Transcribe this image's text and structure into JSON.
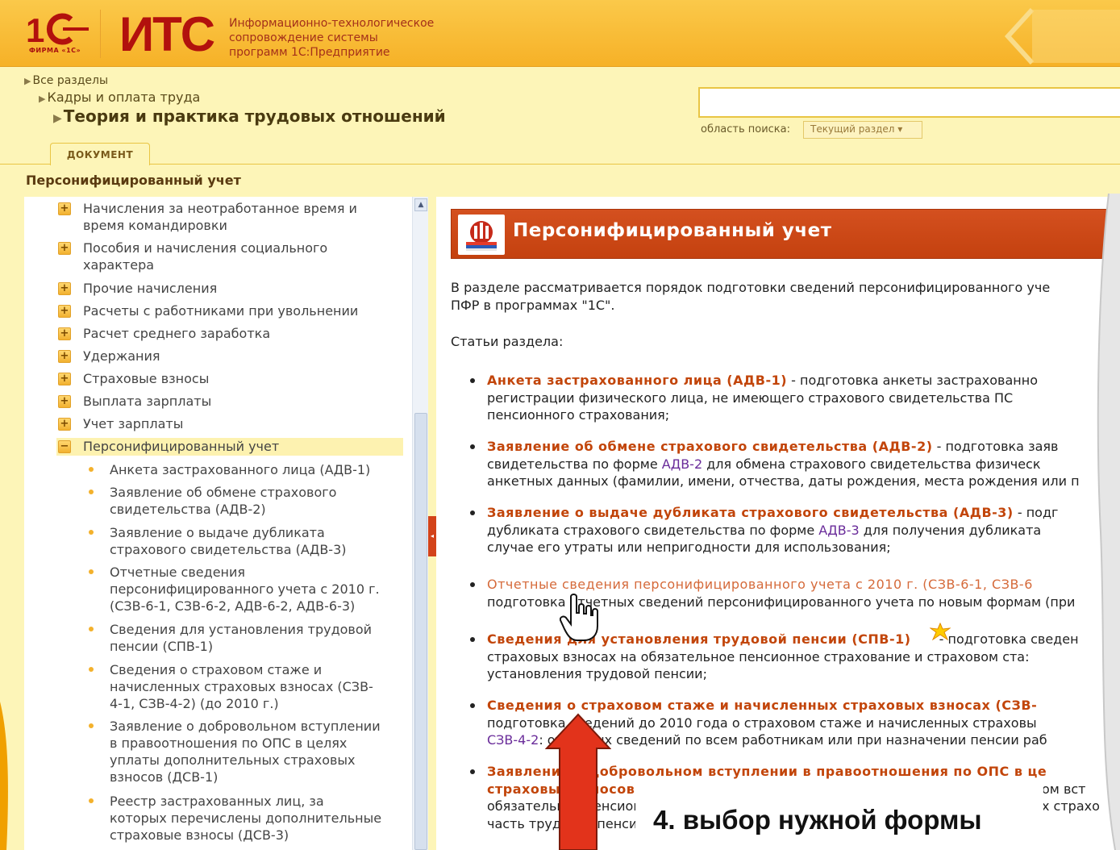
{
  "header": {
    "logo_1c_text": "1С",
    "logo_firm_text": "ФИРМА «1С»",
    "logo_its_text": "ИТС",
    "caption_lines": [
      "Информационно-технологическое",
      "сопровождение системы",
      "программ 1С:Предприятие"
    ]
  },
  "breadcrumbs": [
    "Все разделы",
    "Кадры и оплата труда",
    "Теория и практика трудовых отношений"
  ],
  "search": {
    "value": "",
    "scope_label": "область поиска:",
    "scope_value": "Текущий раздел ▾"
  },
  "tabs": {
    "document": "ДОКУМЕНТ"
  },
  "section_title": "Персонифицированный учет",
  "tree": {
    "items": [
      {
        "label_lines": [
          "Начисления за неотработанное время и",
          "время командировки"
        ],
        "icon": "+"
      },
      {
        "label_lines": [
          "Пособия и начисления социального",
          "характера"
        ],
        "icon": "+"
      },
      {
        "label_lines": [
          "Прочие начисления"
        ],
        "icon": "+"
      },
      {
        "label_lines": [
          "Расчеты с работниками при увольнении"
        ],
        "icon": "+"
      },
      {
        "label_lines": [
          "Расчет среднего заработка"
        ],
        "icon": "+"
      },
      {
        "label_lines": [
          "Удержания"
        ],
        "icon": "+"
      },
      {
        "label_lines": [
          "Страховые взносы"
        ],
        "icon": "+"
      },
      {
        "label_lines": [
          "Выплата зарплаты"
        ],
        "icon": "+"
      },
      {
        "label_lines": [
          "Учет зарплаты"
        ],
        "icon": "+"
      },
      {
        "label_lines": [
          "Персонифицированный учет"
        ],
        "icon": "−"
      }
    ],
    "children": [
      {
        "label_lines": [
          "Анкета застрахованного лица (АДВ-1)"
        ]
      },
      {
        "label_lines": [
          "Заявление об обмене страхового",
          "свидетельства (АДВ-2)"
        ]
      },
      {
        "label_lines": [
          "Заявление о выдаче дубликата",
          "страхового свидетельства (АДВ-3)"
        ]
      },
      {
        "label_lines": [
          "Отчетные сведения",
          "персонифицированного учета с 2010 г.",
          "(СЗВ-6-1, СЗВ-6-2, АДВ-6-2, АДВ-6-3)"
        ]
      },
      {
        "label_lines": [
          "Сведения для установления трудовой",
          "пенсии (СПВ-1)"
        ]
      },
      {
        "label_lines": [
          "Сведения о страховом стаже и",
          "начисленных страховых взносах (СЗВ-",
          "4-1, СЗВ-4-2) (до 2010 г.)"
        ]
      },
      {
        "label_lines": [
          "Заявление о добровольном вступлении",
          "в правоотношения по ОПС в целях",
          "уплаты дополнительных страховых",
          "взносов (ДСВ-1)"
        ]
      },
      {
        "label_lines": [
          "Реестр застрахованных лиц, за",
          "которых перечислены дополнительные",
          "страховые взносы (ДСВ-3)"
        ]
      }
    ]
  },
  "content": {
    "banner_title": "Персонифицированный учет",
    "intro_lines": [
      "В разделе рассматривается порядок подготовки сведений персонифицированного уче",
      "ПФР в программах \"1С\"."
    ],
    "articles_heading": "Статьи раздела:",
    "articles": [
      {
        "title": "Анкета застрахованного лица (АДВ-1)",
        "rest_line1": " - подготовка анкеты застрахованно",
        "lines": [
          "регистрации физического лица, не имеющего страхового свидетельства ПС",
          "пенсионного страхования;"
        ]
      },
      {
        "title": "Заявление об обмене страхового свидетельства (АДВ-2)",
        "rest_line1": " - подготовка заяв",
        "line2_pre": "свидетельства по форме ",
        "line2_ref": "АДВ-2",
        "line2_post": " для обмена страхового свидетельства физическ",
        "lines": [
          "анкетных данных (фамилии, имени, отчества, даты рождения, места рождения или п"
        ]
      },
      {
        "title": "Заявление о выдаче дубликата страхового свидетельства (АДВ-3)",
        "rest_line1": " - подг",
        "line2_pre": "дубликата страхового свидетельства по форме ",
        "line2_ref": "АДВ-3",
        "line2_post": " для получения дубликата",
        "lines": [
          "случае его утраты или непригодности для использования;"
        ]
      },
      {
        "title": "Отчетные сведения персонифицированного учета с 2010 г. (СЗВ-6-1, СЗВ-6",
        "lines": [
          "подготовка отчетных сведений персонифицированного учета по новым формам (при"
        ]
      },
      {
        "title": "Сведения для установления трудовой пенсии (СПВ-1)",
        "rest_line1": " - подготовка сведен",
        "lines": [
          "страховых взносах на обязательное пенсионное страхование и страховом ста:",
          "установления трудовой пенсии;"
        ]
      },
      {
        "title": "Сведения о страховом стаже и начисленных страховых взносах (СЗВ-",
        "line2": "подготовка сведений до 2010 года о страховом стаже и начисленных страховы",
        "line3_ref": "СЗВ-4-2",
        "line3_post": ": отчетных сведений по всем работникам или при назначении пенсии раб"
      },
      {
        "title_a": "Заявление о добровольном вступлении в правоотношения по ОПС в це",
        "title_b": "страховых взносов",
        "lines": [
          "обязательное пенсионное страхование",
          "часть трудовой пенсии"
        ],
        "right_fragments": [
          "ом вст",
          "х страхо"
        ]
      }
    ]
  },
  "annotation": {
    "text": "4. выбор нужной формы",
    "arrow_color": "#e2331b"
  },
  "colors": {
    "header_bg": "#f6b127",
    "page_bg": "#fdf5b8",
    "banner_bg": "#c4410f",
    "link": "#c2450a",
    "ref_link": "#6a2c9a",
    "logo_red": "#b2110d"
  },
  "icons": [
    "logo-1c-icon",
    "chevron-back-icon",
    "expand-plus-icon",
    "collapse-minus-icon",
    "bullet-icon",
    "pfr-logo-icon",
    "hand-cursor-icon",
    "new-star-icon",
    "scroll-up-icon",
    "up-arrow-icon"
  ]
}
